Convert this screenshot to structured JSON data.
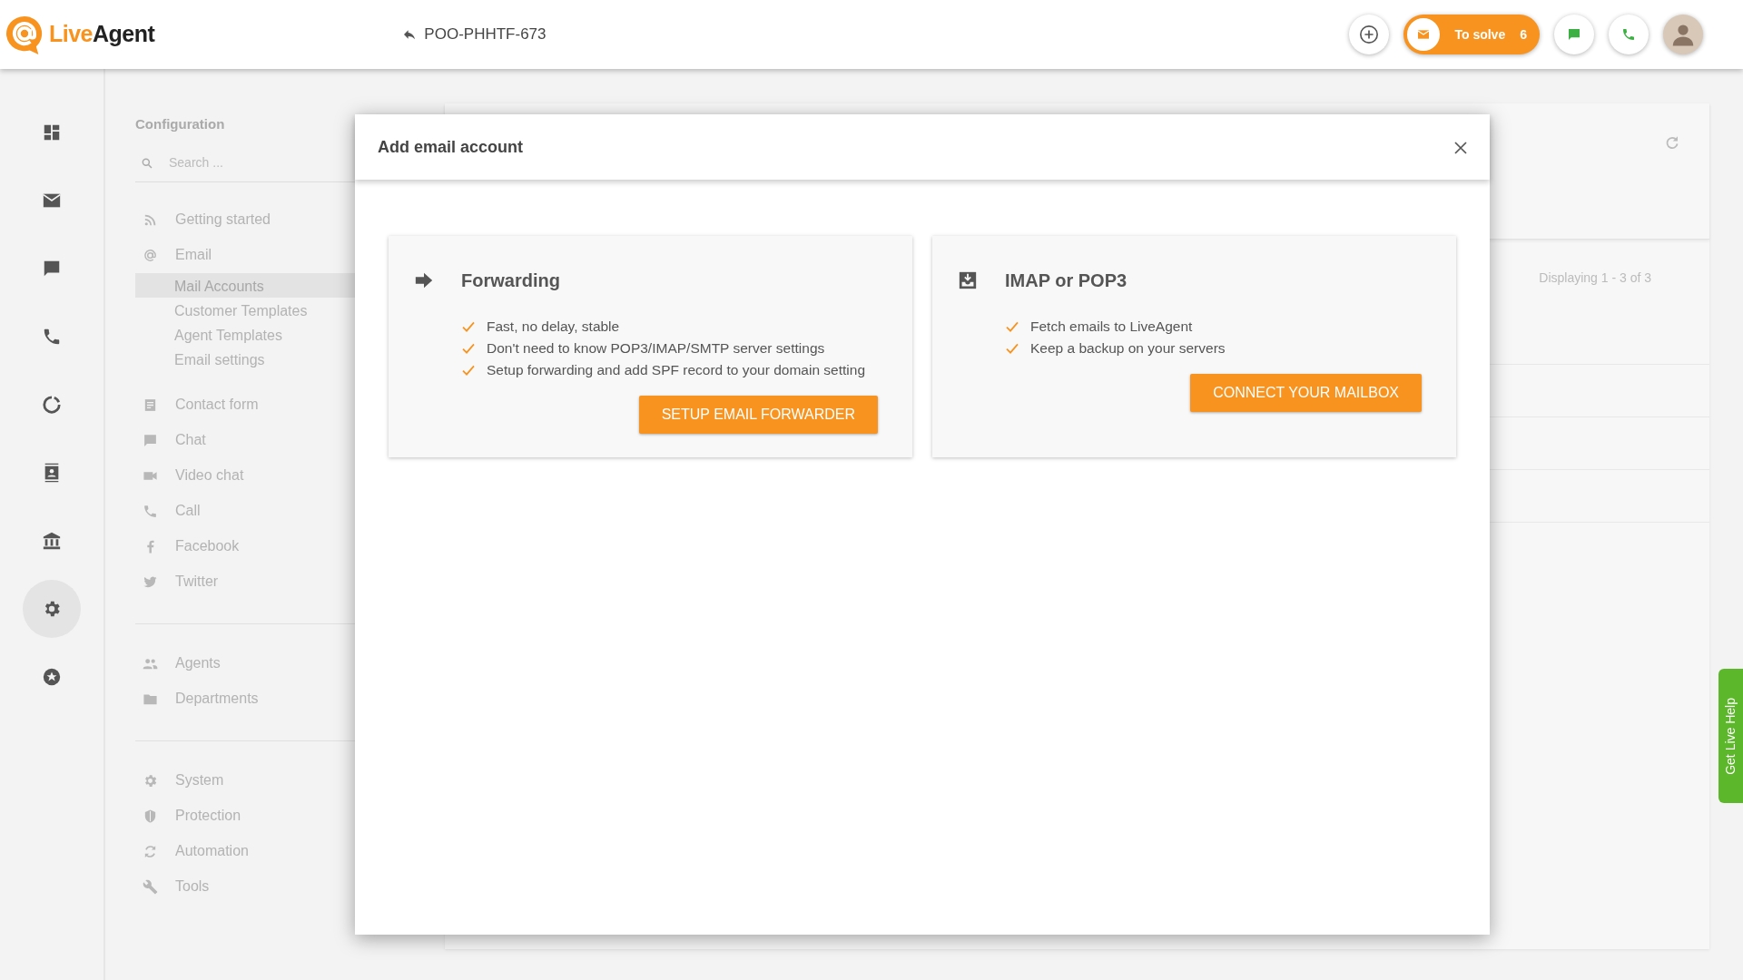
{
  "logo": {
    "brand_first": "Live",
    "brand_second": "Agent"
  },
  "ticket": {
    "id": "POO-PHHTF-673"
  },
  "to_solve": {
    "label": "To solve",
    "count": "6"
  },
  "rail": [
    {
      "selected": false
    },
    {
      "selected": false
    },
    {
      "selected": false
    },
    {
      "selected": false
    },
    {
      "selected": false
    },
    {
      "selected": false
    },
    {
      "selected": false
    },
    {
      "selected": true
    },
    {
      "selected": false
    }
  ],
  "configuration": {
    "title": "Configuration",
    "search": {
      "placeholder": "Search ..."
    },
    "groups": [
      {
        "items": [
          {
            "label": "Getting started"
          },
          {
            "label": "Email",
            "children": [
              {
                "label": "Mail Accounts",
                "selected": true
              },
              {
                "label": "Customer Templates",
                "selected": false
              },
              {
                "label": "Agent Templates",
                "selected": false
              },
              {
                "label": "Email settings",
                "selected": false
              }
            ]
          },
          {
            "label": "Contact form"
          },
          {
            "label": "Chat"
          },
          {
            "label": "Video chat"
          },
          {
            "label": "Call"
          },
          {
            "label": "Facebook"
          },
          {
            "label": "Twitter"
          }
        ]
      },
      {
        "items": [
          {
            "label": "Agents"
          },
          {
            "label": "Departments"
          }
        ]
      },
      {
        "items": [
          {
            "label": "System"
          },
          {
            "label": "Protection"
          },
          {
            "label": "Automation"
          },
          {
            "label": "Tools"
          }
        ]
      }
    ]
  },
  "background_panel": {
    "paging": "Displaying 1 - 3 of 3"
  },
  "modal": {
    "title": "Add email account",
    "options": [
      {
        "title": "Forwarding",
        "features": [
          "Fast, no delay, stable",
          "Don't need to know POP3/IMAP/SMTP server settings",
          "Setup forwarding and add SPF record to your domain setting"
        ],
        "button": "SETUP EMAIL FORWARDER"
      },
      {
        "title": "IMAP or POP3",
        "features": [
          "Fetch emails to LiveAgent",
          "Keep a backup on your servers"
        ],
        "button": "CONNECT YOUR MAILBOX"
      }
    ]
  },
  "live_help": {
    "label": "Get Live Help"
  }
}
